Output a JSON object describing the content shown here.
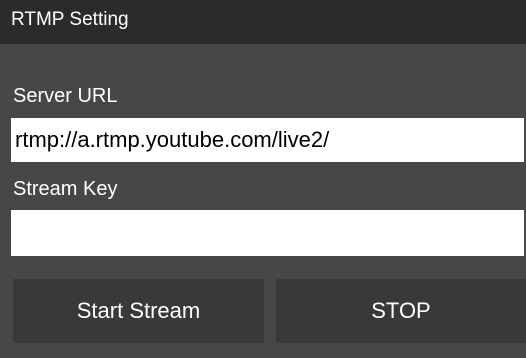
{
  "window": {
    "title": "RTMP Setting"
  },
  "form": {
    "server_url_label": "Server URL",
    "server_url_value": "rtmp://a.rtmp.youtube.com/live2/",
    "stream_key_label": "Stream Key",
    "stream_key_value": ""
  },
  "buttons": {
    "start_label": "Start Stream",
    "stop_label": "STOP"
  },
  "colors": {
    "titlebar": "#2b2b2b",
    "panel": "#474747",
    "button": "#393939",
    "field": "#ffffff",
    "text": "#ffffff"
  }
}
